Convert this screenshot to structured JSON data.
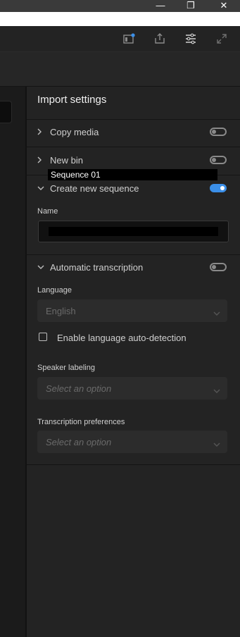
{
  "window": {
    "minimize_glyph": "—",
    "restore_glyph": "❐",
    "close_glyph": "✕"
  },
  "toolbar": {
    "icons": [
      "window-badge-icon",
      "share-icon",
      "settings-list-icon",
      "expand-icon"
    ]
  },
  "panel": {
    "title": "Import settings",
    "copy_media": {
      "label": "Copy media",
      "enabled": false
    },
    "new_bin": {
      "label": "New bin",
      "enabled": false,
      "overlay_text": "Sequence 01"
    },
    "create_sequence": {
      "label": "Create new sequence",
      "enabled": true,
      "name_label": "Name",
      "name_value": ""
    },
    "transcription": {
      "label": "Automatic transcription",
      "enabled": false,
      "language_label": "Language",
      "language_value": "English",
      "auto_detect_label": "Enable language auto-detection",
      "auto_detect_checked": false,
      "speaker_label": "Speaker labeling",
      "speaker_placeholder": "Select an option",
      "prefs_label": "Transcription preferences",
      "prefs_placeholder": "Select an option"
    }
  },
  "colors": {
    "accent": "#3b8fe8",
    "panel_bg": "#232323",
    "text": "#d6d6d6"
  }
}
